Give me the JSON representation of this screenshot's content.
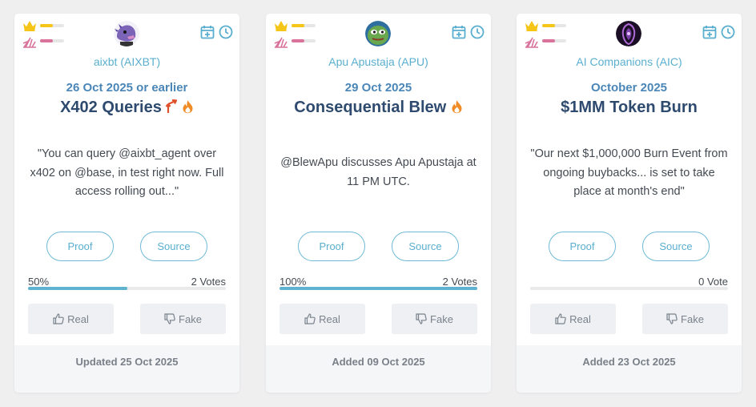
{
  "cards": [
    {
      "ticker": "aixbt (AIXBT)",
      "date": "26 Oct 2025 or earlier",
      "title": "X402 Queries",
      "title_icons": [
        "trending-up-icon",
        "fire-icon"
      ],
      "description": "\"You can query @aixbt_agent over x402 on @base, in test right now. Full access rolling out...\"",
      "proof_label": "Proof",
      "source_label": "Source",
      "percent": "50%",
      "progress_fraction": 0.5,
      "votes": "2 Votes",
      "real_label": "Real",
      "fake_label": "Fake",
      "footer": "Updated 25 Oct 2025"
    },
    {
      "ticker": "Apu Apustaja (APU)",
      "date": "29 Oct 2025",
      "title": "Consequential Blew",
      "title_icons": [
        "fire-icon"
      ],
      "description": "@BlewApu discusses Apu Apustaja at 11 PM UTC.",
      "proof_label": "Proof",
      "source_label": "Source",
      "percent": "100%",
      "progress_fraction": 1.0,
      "votes": "2 Votes",
      "real_label": "Real",
      "fake_label": "Fake",
      "footer": "Added 09 Oct 2025"
    },
    {
      "ticker": "AI Companions (AIC)",
      "date": "October 2025",
      "title": "$1MM Token Burn",
      "title_icons": [],
      "description": "\"Our next $1,000,000 Burn Event from ongoing buybacks... is set to take place at month's end\"",
      "proof_label": "Proof",
      "source_label": "Source",
      "percent": "",
      "progress_fraction": 0,
      "votes": "0 Vote",
      "real_label": "Real",
      "fake_label": "Fake",
      "footer": "Added 23 Oct 2025"
    }
  ],
  "colors": {
    "accent": "#5aafcf",
    "title": "#2e4a6e",
    "date": "#4a86b8",
    "crown": "#f5c518",
    "burst": "#d9739c",
    "fire": "#f08c28",
    "trend": "#e0502a"
  }
}
